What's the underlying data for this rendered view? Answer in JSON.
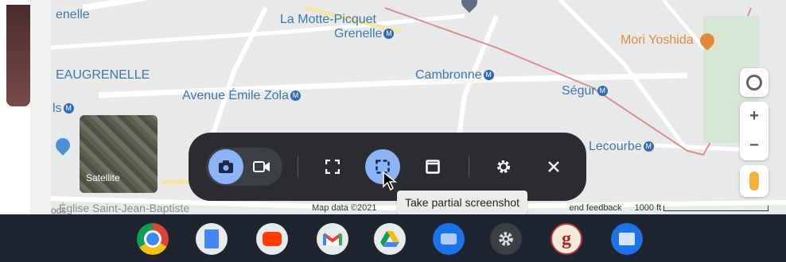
{
  "map": {
    "labels": {
      "grenelle_partial": "enelle",
      "la_motte_picquet": "La Motte-Picquet",
      "grenelle": "Grenelle",
      "beaugrenelle": "EAUGRENELLE",
      "cambronne": "Cambronne",
      "avenue_emile_zola": "Avenue Émile Zola",
      "segur": "Ségur",
      "mori_yoshida": "Mori Yoshida",
      "lecourbe": "Lecourbe",
      "eglise": "Église Saint-Jean-Baptiste",
      "ls_partial": "ls",
      "ods_partial": "ods",
      "metro_symbol": "M"
    },
    "satellite_label": "Satellite",
    "attribution": {
      "map_data": "Map data ©2021",
      "feedback": "end feedback",
      "scale": "1000 ft"
    },
    "controls": {
      "zoom_in": "+",
      "zoom_out": "−"
    }
  },
  "capture_bar": {
    "tooltip": "Take partial screenshot",
    "colors": {
      "background": "#2a2c30",
      "active": "#8ab4f8"
    }
  },
  "shelf": {
    "apps": [
      {
        "name": "Chrome",
        "icon": "chrome-icon"
      },
      {
        "name": "Google Docs",
        "icon": "docs-icon"
      },
      {
        "name": "YouTube",
        "icon": "youtube-icon"
      },
      {
        "name": "Gmail",
        "icon": "gmail-icon"
      },
      {
        "name": "Google Drive",
        "icon": "drive-icon"
      },
      {
        "name": "Messages",
        "icon": "messages-icon"
      },
      {
        "name": "Settings",
        "icon": "settings-icon"
      },
      {
        "name": "Goodreads",
        "icon": "goodreads-icon",
        "letter": "g"
      },
      {
        "name": "Files",
        "icon": "files-icon"
      }
    ]
  }
}
